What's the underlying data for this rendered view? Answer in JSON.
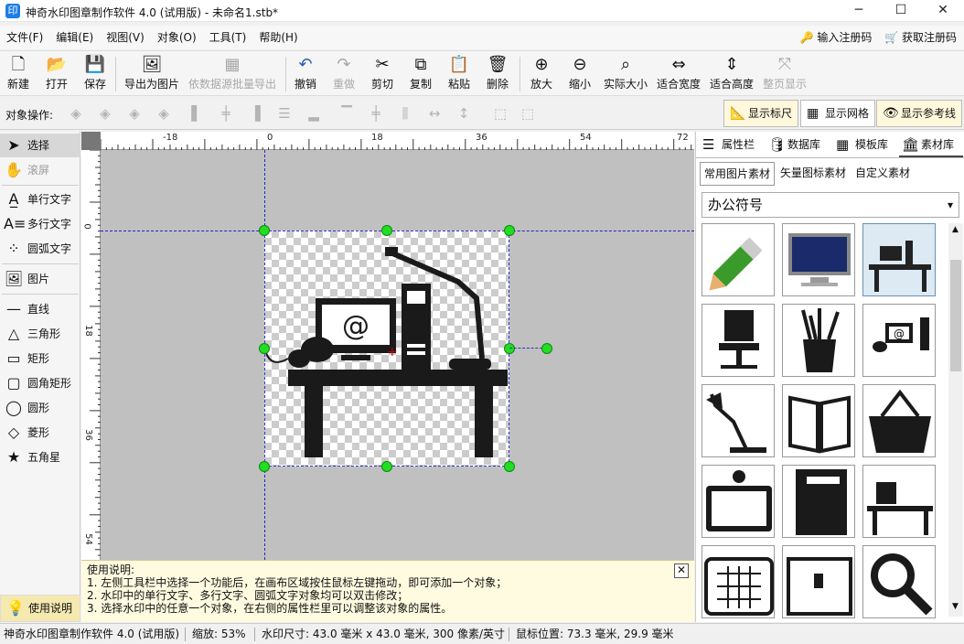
{
  "window": {
    "title": "神奇水印图章制作软件 4.0 (试用版) - 未命名1.stb*",
    "app_icon": "印",
    "controls": [
      "─",
      "☐",
      "✕"
    ]
  },
  "menu": {
    "items": [
      "文件(F)",
      "编辑(E)",
      "视图(V)",
      "对象(O)",
      "工具(T)",
      "帮助(H)"
    ],
    "register": "输入注册码",
    "get_code": "获取注册码"
  },
  "toolbar": {
    "new": "新建",
    "open": "打开",
    "save": "保存",
    "export_image": "导出为图片",
    "batch_export": "依数据源批量导出",
    "undo": "撤销",
    "redo": "重做",
    "cut": "剪切",
    "copy": "复制",
    "paste": "粘贴",
    "delete": "删除",
    "zoom_in": "放大",
    "zoom_out": "缩小",
    "actual_size": "实际大小",
    "fit_width": "适合宽度",
    "fit_height": "适合高度",
    "full_page": "整页显示"
  },
  "object_ops": {
    "label": "对象操作:",
    "show_ruler": "显示标尺",
    "show_grid": "显示网格",
    "show_guides": "显示参考线"
  },
  "left_tools": {
    "select": "选择",
    "scroll": "滚屏",
    "single_text": "单行文字",
    "multi_text": "多行文字",
    "arc_text": "圆弧文字",
    "image": "图片",
    "line": "直线",
    "triangle": "三角形",
    "rect": "矩形",
    "round_rect": "圆角矩形",
    "circle": "圆形",
    "diamond": "菱形",
    "star": "五角星",
    "help": "使用说明"
  },
  "ruler": {
    "h_labels": [
      "-18",
      "0",
      "18",
      "36",
      "54",
      "72"
    ],
    "v_labels": [
      "0",
      "18",
      "36",
      "54"
    ]
  },
  "help_box": {
    "title": "使用说明:",
    "line1": "1. 左侧工具栏中选择一个功能后，在画布区域按住鼠标左键拖动，即可添加一个对象；",
    "line2": "2. 水印中的单行文字、多行文字、圆弧文字对象均可以双击修改；",
    "line3": "3. 选择水印中的任意一个对象，在右侧的属性栏里可以调整该对象的属性。",
    "close": "✕"
  },
  "right_panel": {
    "tabs": [
      "属性栏",
      "数据库",
      "模板库",
      "素材库"
    ],
    "subtabs": [
      "常用图片素材",
      "矢量图标素材",
      "自定义素材"
    ],
    "category": "办公符号",
    "category_arrow": "▾"
  },
  "status": {
    "app": "神奇水印图章制作软件 4.0 (试用版)",
    "zoom": "缩放: 53%",
    "size": "水印尺寸: 43.0 毫米 x 43.0 毫米, 300 像素/英寸",
    "mouse": "鼠标位置: 73.3 毫米, 29.9 毫米"
  }
}
